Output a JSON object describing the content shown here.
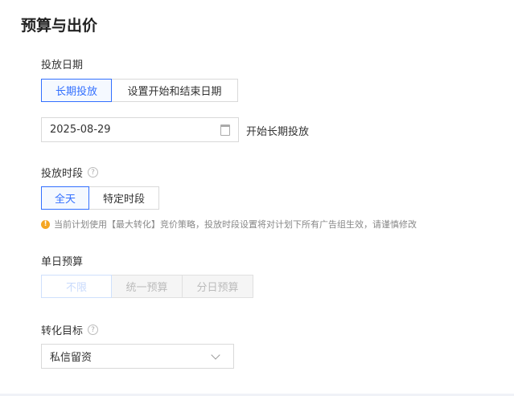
{
  "title": "预算与出价",
  "delivery_date": {
    "label": "投放日期",
    "options": [
      "长期投放",
      "设置开始和结束日期"
    ],
    "selected": 0,
    "date_value": "2025-08-29",
    "date_hint": "开始长期投放"
  },
  "delivery_time": {
    "label": "投放时段",
    "options": [
      "全天",
      "特定时段"
    ],
    "selected": 0,
    "warning": "当前计划使用【最大转化】竞价策略，投放时段设置将对计划下所有广告组生效，请谨慎修改"
  },
  "daily_budget": {
    "label": "单日预算",
    "options": [
      "不限",
      "统一预算",
      "分日预算"
    ],
    "selected": 0
  },
  "conversion_goal": {
    "label": "转化目标",
    "value": "私信留资"
  }
}
